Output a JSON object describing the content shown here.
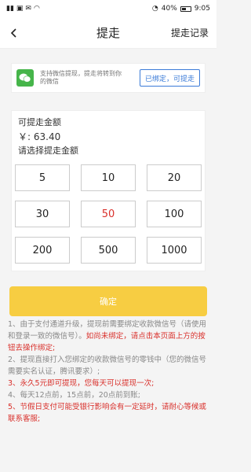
{
  "status_bar": {
    "battery": "40%",
    "time": "9:05"
  },
  "header": {
    "title": "提走",
    "record_link": "提走记录"
  },
  "wechat": {
    "text": "支持微信提现，提走将转到你的微信",
    "bound_button": "已绑定，可提走"
  },
  "amount": {
    "label": "可提走金额",
    "value": "￥: 63.40",
    "hint": "请选择提走金额",
    "options": [
      "5",
      "10",
      "20",
      "30",
      "50",
      "100",
      "200",
      "500",
      "1000"
    ],
    "selected": "50"
  },
  "confirm_button": "确定",
  "notes": [
    {
      "a": "1、由于支付通道升级，提现前需要绑定收款微信号（请使用和登录一致的微信号）。",
      "b": "如尚未绑定，请点击本页面上方的按钮去操作绑定;"
    },
    {
      "a": "2、提现直接打入您绑定的收款微信号的零钱中（您的微信号需要实名认证，腾讯要求）;",
      "b": ""
    },
    {
      "a": "",
      "b": "3、永久5元即可提现，您每天可以提现一次;"
    },
    {
      "a": "4、每天12点前，15点前，20点前到账;",
      "b": ""
    },
    {
      "a": "",
      "b": "5、节假日支付可能受银行影响会有一定延时，请耐心等候或联系客服;"
    }
  ],
  "colors": {
    "accent": "#f7cd42",
    "red": "#d9302b",
    "link_blue": "#3b7bd8",
    "wechat_green": "#46b54a"
  }
}
